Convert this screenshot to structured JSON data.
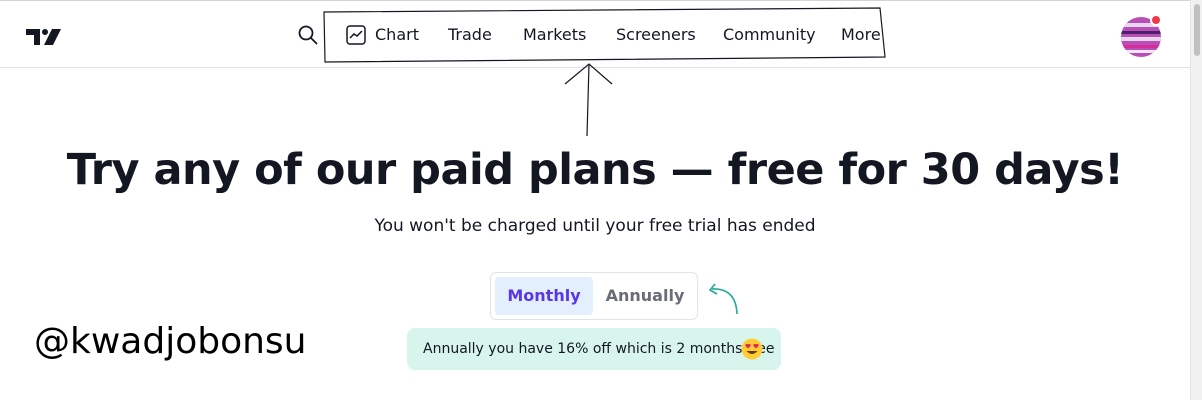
{
  "header": {
    "logo": "tradingview-logo",
    "search_icon": "search-icon",
    "nav": {
      "chart": "Chart",
      "trade": "Trade",
      "markets": "Markets",
      "screeners": "Screeners",
      "community": "Community",
      "more": "More"
    },
    "avatar_has_notification": true
  },
  "hero": {
    "title": "Try any of our paid plans — free for 30 days!",
    "subtitle": "You won't be charged until your free trial has ended"
  },
  "billing_toggle": {
    "monthly": "Monthly",
    "annually": "Annually",
    "selected": "Monthly"
  },
  "discount_note": {
    "text": "Annually you have 16% off which is 2 months free",
    "emoji": "heart-eyes-emoji"
  },
  "watermark": "@kwadjobonsu",
  "colors": {
    "accent": "#5b36e5",
    "selected_bg": "#e3effd",
    "note_bg": "#d7f5ec",
    "teal_arrow": "#22ab94",
    "notification": "#f23645"
  }
}
